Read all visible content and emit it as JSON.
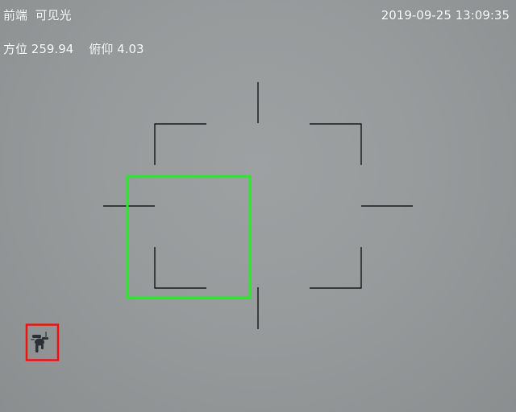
{
  "osd": {
    "camera_source": "前端",
    "camera_mode": "可见光",
    "timestamp": "2019-09-25 13:09:35",
    "azimuth_label": "方位",
    "azimuth_value": "259.94",
    "elevation_label": "俯仰",
    "elevation_value": "4.03"
  },
  "colors": {
    "reticle": "#000000",
    "track_box": "#22ee22",
    "target_box": "#ee1111",
    "osd_text": "#ffffff",
    "sky": "#979b9c"
  },
  "icons": {
    "target": "drone-target-icon"
  }
}
